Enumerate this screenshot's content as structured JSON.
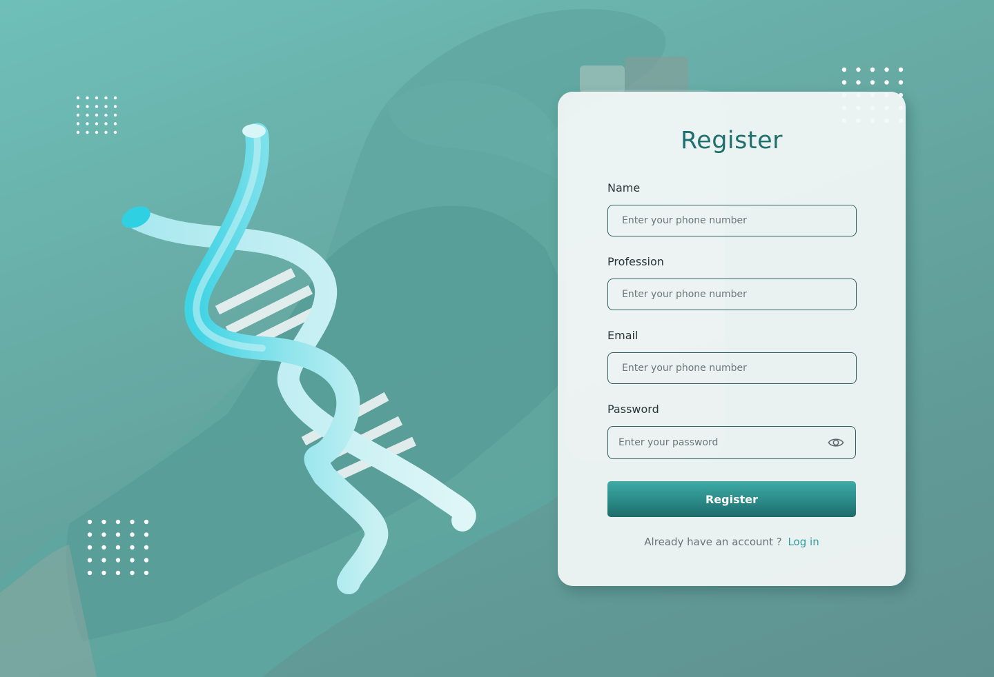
{
  "form": {
    "title": "Register",
    "fields": [
      {
        "label": "Name",
        "placeholder": "Enter your phone number",
        "value": ""
      },
      {
        "label": "Profession",
        "placeholder": "Enter your phone number",
        "value": ""
      },
      {
        "label": "Email",
        "placeholder": "Enter your phone number",
        "value": ""
      },
      {
        "label": "Password",
        "placeholder": "Enter your password",
        "value": ""
      }
    ],
    "submit_label": "Register",
    "footer_text": "Already have an account ?",
    "login_link": "Log in"
  },
  "icons": {
    "password_toggle": "eye-icon"
  },
  "colors": {
    "accent": "#2a8a87",
    "title": "#1f6f6d",
    "link": "#2a9e9b",
    "background": "#68aca6"
  }
}
